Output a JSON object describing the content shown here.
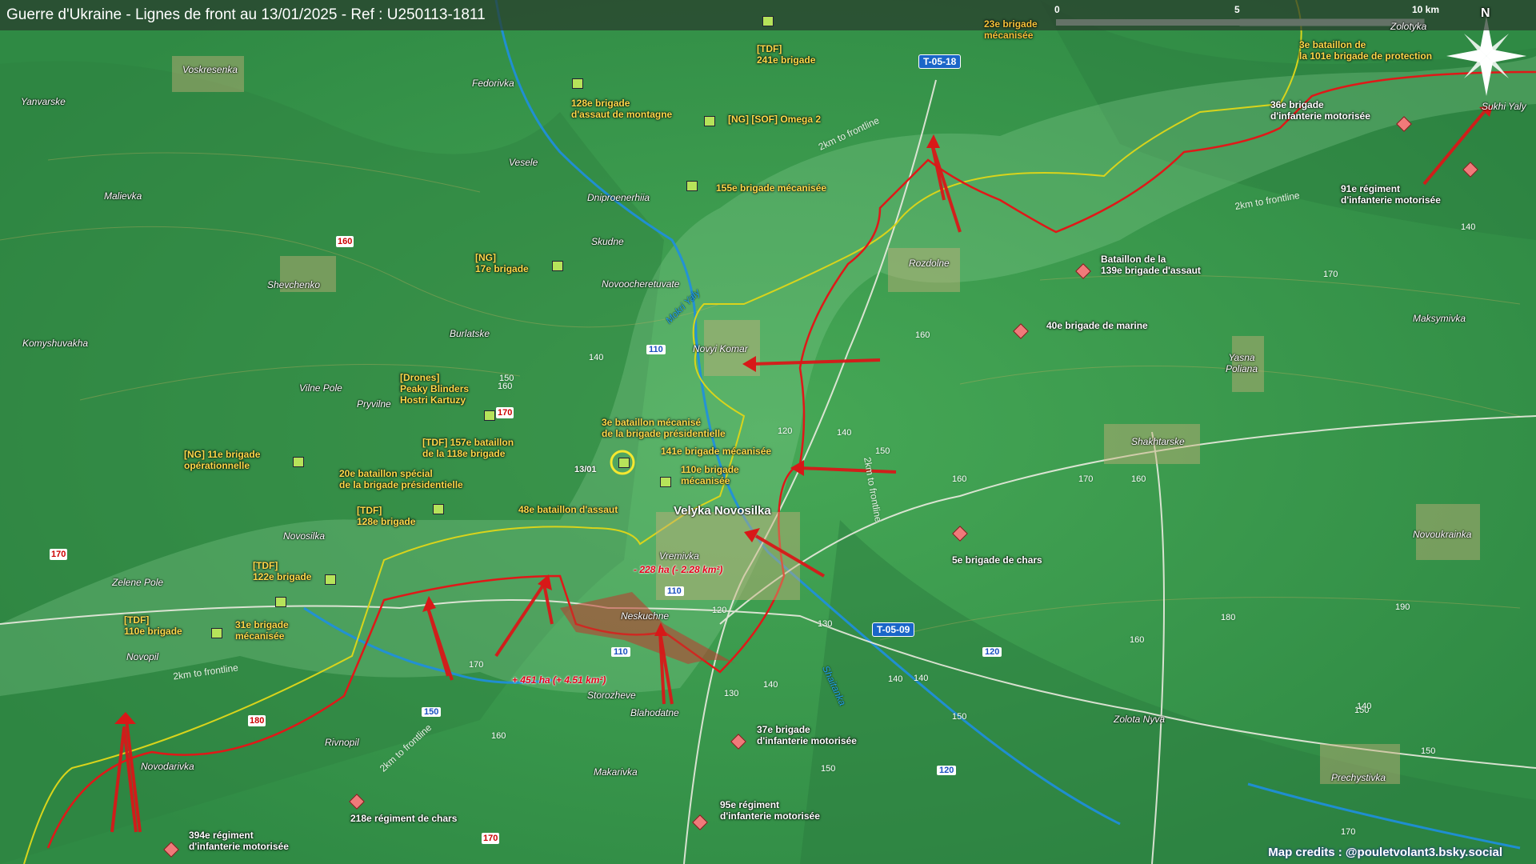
{
  "header": {
    "title": "Guerre d'Ukraine - Lignes de front au 13/01/2025 - Ref : U250113-1811"
  },
  "scale": {
    "labels": [
      "0",
      "5",
      "10 km"
    ]
  },
  "compass": {
    "label": "N"
  },
  "credits": "Map credits : @pouletvolant3.bsky.social",
  "colors": {
    "ru_front": "#e01818",
    "ua_line": "#d8d41c",
    "terrain": "#3d9a4f",
    "ua_unit": "#b6e35a",
    "ru_unit": "#f07a7a"
  },
  "towns": {
    "voskresenka": "Voskresenka",
    "yanvarske": "Yanvarske",
    "fedorivka": "Fedorivka",
    "veselie": "Vesele",
    "malievka": "Malievka",
    "dniproenerhiia": "Dniproenerhiia",
    "skudne": "Skudne",
    "shevchenko": "Shevchenko",
    "novoocheretuvate": "Novoocheretuvate",
    "komyshuvakha": "Komyshuvakha",
    "burlatske": "Burlatske",
    "vilne_pole": "Vilne Pole",
    "pryvilne": "Pryvilne",
    "novyi_komar": "Novyi Komar",
    "rozdolne": "Rozdolne",
    "velyka_novosilka": "Velyka Novosilka",
    "vremivka": "Vremivka",
    "neskuchne": "Neskuchne",
    "novosilka": "Novosilka",
    "zelene_pole": "Zelene Pole",
    "novopil": "Novopil",
    "novodarivka": "Novodarivka",
    "storozheve": "Storozheve",
    "blahodatne": "Blahodatne",
    "rivnopil": "Rivnopil",
    "makarivka": "Makarivka",
    "yasna_poliana": "Yasna\nPoliana",
    "shakhtarske": "Shakhtarske",
    "maksymivka": "Maksymivka",
    "novoukrainka": "Novoukrainka",
    "zolota_nyva": "Zolota Nyva",
    "prechystivka": "Prechystivka",
    "sukhi_yaly": "Sukhi Yaly",
    "zolotyka": "Zolotyka"
  },
  "rivers": {
    "mokri_yaly": "Mokri Yaly",
    "shaitanka": "Shaitanka"
  },
  "roads": {
    "t0518": "T-05-18",
    "t0509": "T-05-09",
    "r110a": "110",
    "r110b": "110",
    "r110c": "110",
    "r150": "150",
    "r120a": "120",
    "r120b": "120"
  },
  "frontline_labels": {
    "a": "2km to frontline",
    "b": "2km to frontline",
    "c": "2km to frontline",
    "d": "2km to frontline",
    "e": "2km to frontline"
  },
  "areas": {
    "loss": "- 228 ha (- 2.28 km²)",
    "gain": "+ 451 ha (+ 4.51 km²)"
  },
  "date_mark": "13/01",
  "elevations": {
    "e160a": "160",
    "e150a": "150",
    "e140a": "140",
    "e160b": "160",
    "e140b": "140",
    "e120a": "120",
    "e150b": "150",
    "e160c": "160",
    "e170a": "170",
    "e160d": "160",
    "e170b": "170",
    "e140c": "140",
    "e180a": "180",
    "e190": "190",
    "e160e": "160",
    "e150c": "150",
    "e140d": "140",
    "e130a": "130",
    "e120b": "120",
    "e130b": "130",
    "e140e": "140",
    "e150d": "150",
    "e140f": "140",
    "e150e": "150",
    "e170c": "170",
    "e160f": "160",
    "e150f": "150",
    "e140g": "140",
    "e170d": "170"
  },
  "elevations_red": {
    "r160": "160",
    "r170a": "170",
    "r170b": "170",
    "r180": "180",
    "r170c": "170"
  },
  "units_ua": {
    "u1": "[TDF]\n241e brigade",
    "u2": "23e brigade\nmécanisée",
    "u3": "128e brigade\nd'assaut de montagne",
    "u4": "[NG] [SOF] Omega 2",
    "u5": "155e brigade mécanisée",
    "u6": "[NG]\n17e brigade",
    "u7": "3e bataillon de\nla 101e brigade de protection",
    "u8": "[Drones]\nPeaky Blinders\nHostri Kartuzy",
    "u9": "3e bataillon mécanisé\nde la brigade présidentielle",
    "u10": "[TDF] 157e bataillon\nde la 118e brigade",
    "u11": "141e brigade mécanisée",
    "u12": "110e brigade\nmécanisée",
    "u13": "[NG] 11e brigade\nopérationnelle",
    "u14": "20e bataillon spécial\nde la brigade présidentielle",
    "u15": "48e bataillon d'assaut",
    "u16": "[TDF]\n128e brigade",
    "u17": "[TDF]\n122e brigade",
    "u18": "[TDF]\n110e brigade",
    "u19": "31e brigade\nmécanisée"
  },
  "units_ru": {
    "r1": "36e brigade\nd'infanterie motorisée",
    "r2": "91e régiment\nd'infanterie motorisée",
    "r3": "Bataillon de la\n139e brigade d'assaut",
    "r4": "40e brigade de marine",
    "r5": "5e brigade de chars",
    "r6": "37e brigade\nd'infanterie motorisée",
    "r7": "95e régiment\nd'infanterie motorisée",
    "r8": "218e régiment de chars",
    "r9": "394e régiment\nd'infanterie motorisée"
  }
}
